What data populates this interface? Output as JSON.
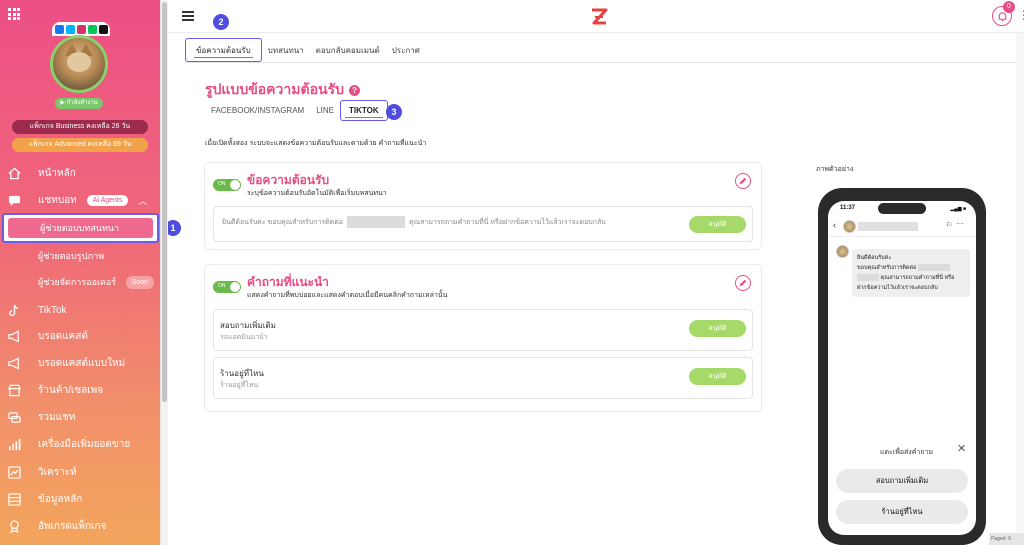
{
  "sidebar": {
    "status": "กำลังทำงาน",
    "package_business": "แพ็กเกจ Business คงเหลือ 26 วัน",
    "package_advanced": "แพ็กเกจ Advanced คงเหลือ 69 วัน",
    "items": [
      {
        "label": "หน้าหลัก"
      },
      {
        "label": "แชทบอท",
        "badge": "Ai Agents"
      },
      {
        "label": "TikTok"
      },
      {
        "label": "บรอดแคสต์"
      },
      {
        "label": "บรอดแคสต์แบบใหม่"
      },
      {
        "label": "ร้านค้า/เซลเพจ"
      },
      {
        "label": "รวมแชท"
      },
      {
        "label": "เครื่องมือเพิ่มยอดขาย"
      },
      {
        "label": "วิเคราะห์"
      },
      {
        "label": "ข้อมูลหลัก"
      },
      {
        "label": "อัพเกรดแพ็กเกจ"
      }
    ],
    "subitems": [
      {
        "label": "ผู้ช่วยตอบบทสนทนา"
      },
      {
        "label": "ผู้ช่วยตอบรูปภาพ"
      },
      {
        "label": "ผู้ช่วยจัดการออเดอร์",
        "badge": "Soon"
      }
    ]
  },
  "topbar": {
    "notification_count": "0"
  },
  "markers": {
    "one": "1",
    "two": "2",
    "three": "3"
  },
  "tabs": [
    {
      "label": "ข้อความต้อนรับ"
    },
    {
      "label": "บทสนทนา"
    },
    {
      "label": "ตอบกลับคอมเมนต์"
    },
    {
      "label": "ประกาศ"
    }
  ],
  "section_title": "รูปแบบข้อความต้อนรับ",
  "platform_tabs": [
    {
      "label": "FACEBOOK/INSTAGRAM"
    },
    {
      "label": "LINE"
    },
    {
      "label": "TIKTOK"
    }
  ],
  "description": "เมื่อเปิดทั้งสอง ระบบจะแสดงข้อความต้อนรับและตามด้วย คำถามที่แนะนำ",
  "welcome": {
    "toggle": "ON",
    "title": "ข้อความต้อนรับ",
    "subtitle": "ระบุข้อความต้อนรับอัตโนมัติเพื่อเริ่มบทสนทนา",
    "message_start": "ยินดีต้อนรับค่ะ ขอบคุณสำหรับการติดต่อ",
    "message_end": "คุณสามารถถามคำถามที่นี่ หรือฝากข้อความไว้แล้วเราจะตอบกลับ",
    "approve": "อนุมัติ"
  },
  "suggested": {
    "toggle": "ON",
    "title": "คำถามที่แนะนำ",
    "subtitle": "แสดงคำถามที่พบบ่อยและแสดงคำตอบเมื่อมีคนคลิกคำถามเหล่านั้น",
    "questions": [
      {
        "title": "สอบถามเพิ่มเติม",
        "sub": "รอแอดมินมาบ้า",
        "approve": "อนุมัติ"
      },
      {
        "title": "ร้านอยู่ที่ไหน",
        "sub": "ร้านอยู่ที่ไหน",
        "approve": "อนุมัติ"
      }
    ]
  },
  "preview": {
    "label": "ภาพตัวอย่าง",
    "time": "11:37",
    "line1": "ยินดีต้อนรับค่ะ",
    "line2": "ขอบคุณสำหรับการติดต่อ",
    "line3": "คุณสามารถถามคำถามที่นี่ หรือ",
    "line4": "ฝากข้อความไว้แล้วเราจะตอบกลับ",
    "tap": "แตะเพื่อส่งคำถาม",
    "btn1": "สอบถามเพิ่มเติม",
    "btn2": "ร้านอยู่ที่ไหน"
  },
  "paged": "Paged: 6"
}
